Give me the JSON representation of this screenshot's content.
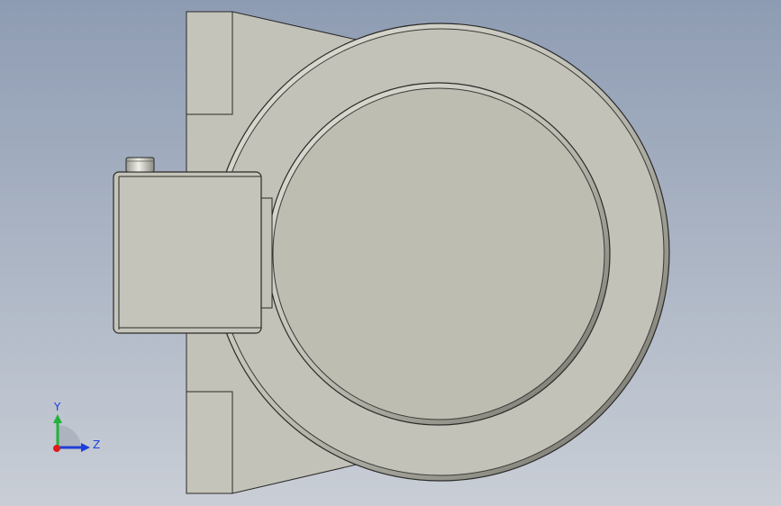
{
  "viewport": {
    "background_top": "#8e9cb3",
    "background_bottom": "#c9ced6"
  },
  "part": {
    "body_fill": "#c2c2b8",
    "face_fill": "#bdbdb2",
    "edge_color": "#2a2a28",
    "highlight": "#e8e8e0",
    "shadow": "#8a8a82"
  },
  "triad": {
    "y_label": "Y",
    "z_label": "Z",
    "y_color": "#22b33a",
    "z_color": "#1f3fd6",
    "x_color": "#e01b1b",
    "label_color": "#1f3fd6"
  }
}
